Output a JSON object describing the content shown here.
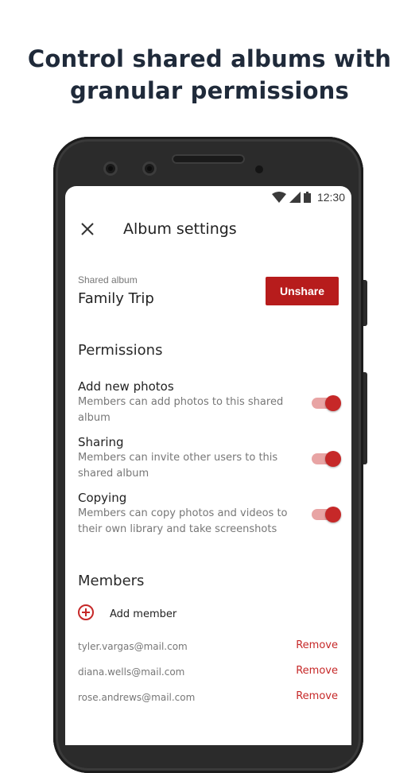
{
  "headline": {
    "line1": "Control shared albums with",
    "line2": "granular permissions"
  },
  "status_bar": {
    "time": "12:30",
    "icons": [
      "wifi-icon",
      "cell-signal-icon",
      "battery-icon"
    ]
  },
  "app_bar": {
    "title": "Album settings",
    "close_icon": "close-icon"
  },
  "album": {
    "label": "Shared album",
    "name": "Family Trip",
    "unshare_label": "Unshare"
  },
  "permissions": {
    "title": "Permissions",
    "items": [
      {
        "title": "Add new photos",
        "desc": "Members can add photos to this shared album",
        "enabled": true
      },
      {
        "title": "Sharing",
        "desc": "Members can invite other users to this shared album",
        "enabled": true
      },
      {
        "title": "Copying",
        "desc": "Members can copy photos and videos to their own library and take screenshots",
        "enabled": true
      }
    ]
  },
  "members": {
    "title": "Members",
    "add_label": "Add member",
    "add_icon": "add-circle-icon",
    "list": [
      {
        "email": "tyler.vargas@mail.com",
        "action": "Remove"
      },
      {
        "email": "diana.wells@mail.com",
        "action": "Remove"
      },
      {
        "email": "rose.andrews@mail.com",
        "action": "Remove"
      }
    ]
  },
  "colors": {
    "accent": "#b71c1c",
    "toggle_thumb": "#c62828",
    "toggle_track": "#e8a4a4",
    "headline": "#1f2a3a",
    "phone_body": "#2b2b2b"
  }
}
